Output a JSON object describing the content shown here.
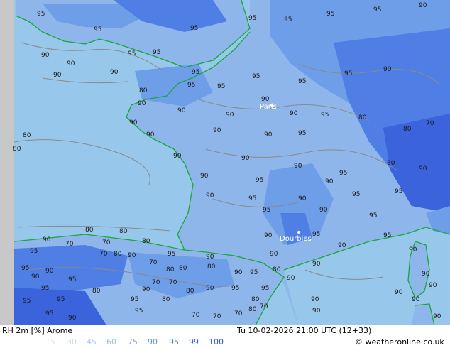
{
  "map": {
    "location_labels": [
      {
        "name": "Paris"
      },
      {
        "name": "Dourbies"
      }
    ],
    "colors": {
      "sea": "#97c7ea",
      "land_light": "#8fb6ea",
      "land_mid": "#6f9ee9",
      "land_dark": "#4f7fe4",
      "land_deep": "#3a63dc",
      "coast": "#17a83a",
      "contour": "#8a8a8a",
      "left_strip": "#c8c8c8"
    },
    "contour_labels": [
      {
        "value": "95"
      },
      {
        "value": "90"
      },
      {
        "value": "80"
      },
      {
        "value": "70"
      }
    ]
  },
  "footer": {
    "variable_label": "RH 2m [%] Arome",
    "valid_time": "Tu 10-02-2026 21:00 UTC (12+33)",
    "copyright": "© weatheronline.co.uk",
    "legend": [
      {
        "value": "15",
        "color": "#dde8f5"
      },
      {
        "value": "30",
        "color": "#c9dbf1"
      },
      {
        "value": "45",
        "color": "#b2cbec"
      },
      {
        "value": "60",
        "color": "#9cbfe8"
      },
      {
        "value": "75",
        "color": "#7fa9e3"
      },
      {
        "value": "90",
        "color": "#6594df"
      },
      {
        "value": "95",
        "color": "#4a79da"
      },
      {
        "value": "99",
        "color": "#3a64d6"
      },
      {
        "value": "100",
        "color": "#2c50d0"
      }
    ]
  }
}
